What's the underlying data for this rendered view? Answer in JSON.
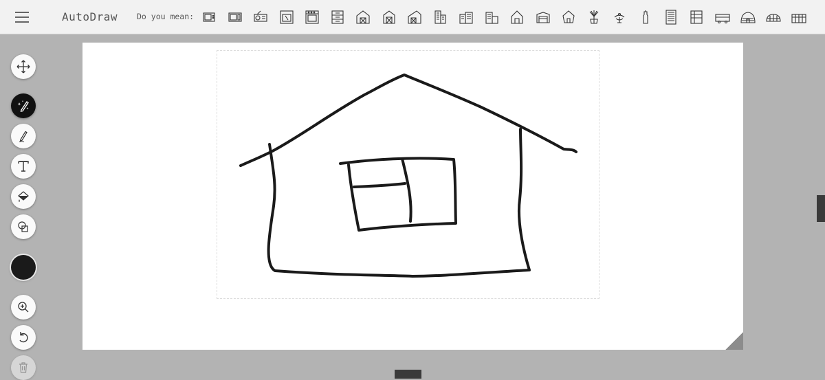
{
  "app": {
    "title": "AutoDraw"
  },
  "suggestions": {
    "label": "Do you mean:",
    "items": [
      "tv-icon",
      "microwave-icon",
      "radio-icon",
      "oven-icon",
      "stove-icon",
      "cabinet-icon",
      "barn-icon",
      "barn-2-icon",
      "barn-3-icon",
      "apartment-building-icon",
      "city-block-icon",
      "townhouse-icon",
      "house-icon",
      "shed-icon",
      "hut-icon",
      "potted-plant-icon",
      "bird-plant-icon",
      "bottle-plant-icon",
      "skyscraper-icon",
      "store-icon",
      "bus-icon",
      "igloo-icon",
      "dome-building-icon",
      "greenhouse-icon"
    ]
  },
  "toolbar": {
    "tools": [
      {
        "id": "move",
        "icon": "move-icon"
      },
      {
        "id": "autodraw",
        "icon": "autodraw-icon"
      },
      {
        "id": "draw",
        "icon": "pencil-icon"
      },
      {
        "id": "type",
        "icon": "text-icon"
      },
      {
        "id": "fill",
        "icon": "fill-bucket-icon"
      },
      {
        "id": "shape",
        "icon": "shape-icon"
      },
      {
        "id": "zoom",
        "icon": "zoom-in-icon"
      },
      {
        "id": "undo",
        "icon": "undo-icon"
      },
      {
        "id": "delete",
        "icon": "trash-icon"
      }
    ],
    "active_tool": "autodraw",
    "current_color": "#1a1a1a"
  },
  "colors": {
    "topbar_bg": "#f2f2f2",
    "workspace_bg": "#b3b3b3",
    "ink": "#1a1a1a"
  }
}
